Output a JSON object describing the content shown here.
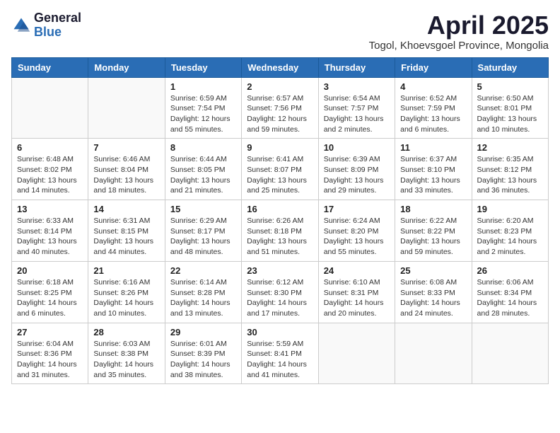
{
  "header": {
    "logo_general": "General",
    "logo_blue": "Blue",
    "month_title": "April 2025",
    "location": "Togol, Khoevsgoel Province, Mongolia"
  },
  "weekdays": [
    "Sunday",
    "Monday",
    "Tuesday",
    "Wednesday",
    "Thursday",
    "Friday",
    "Saturday"
  ],
  "weeks": [
    [
      {
        "day": "",
        "empty": true
      },
      {
        "day": "",
        "empty": true
      },
      {
        "day": "1",
        "line1": "Sunrise: 6:59 AM",
        "line2": "Sunset: 7:54 PM",
        "line3": "Daylight: 12 hours",
        "line4": "and 55 minutes."
      },
      {
        "day": "2",
        "line1": "Sunrise: 6:57 AM",
        "line2": "Sunset: 7:56 PM",
        "line3": "Daylight: 12 hours",
        "line4": "and 59 minutes."
      },
      {
        "day": "3",
        "line1": "Sunrise: 6:54 AM",
        "line2": "Sunset: 7:57 PM",
        "line3": "Daylight: 13 hours",
        "line4": "and 2 minutes."
      },
      {
        "day": "4",
        "line1": "Sunrise: 6:52 AM",
        "line2": "Sunset: 7:59 PM",
        "line3": "Daylight: 13 hours",
        "line4": "and 6 minutes."
      },
      {
        "day": "5",
        "line1": "Sunrise: 6:50 AM",
        "line2": "Sunset: 8:01 PM",
        "line3": "Daylight: 13 hours",
        "line4": "and 10 minutes."
      }
    ],
    [
      {
        "day": "6",
        "line1": "Sunrise: 6:48 AM",
        "line2": "Sunset: 8:02 PM",
        "line3": "Daylight: 13 hours",
        "line4": "and 14 minutes."
      },
      {
        "day": "7",
        "line1": "Sunrise: 6:46 AM",
        "line2": "Sunset: 8:04 PM",
        "line3": "Daylight: 13 hours",
        "line4": "and 18 minutes."
      },
      {
        "day": "8",
        "line1": "Sunrise: 6:44 AM",
        "line2": "Sunset: 8:05 PM",
        "line3": "Daylight: 13 hours",
        "line4": "and 21 minutes."
      },
      {
        "day": "9",
        "line1": "Sunrise: 6:41 AM",
        "line2": "Sunset: 8:07 PM",
        "line3": "Daylight: 13 hours",
        "line4": "and 25 minutes."
      },
      {
        "day": "10",
        "line1": "Sunrise: 6:39 AM",
        "line2": "Sunset: 8:09 PM",
        "line3": "Daylight: 13 hours",
        "line4": "and 29 minutes."
      },
      {
        "day": "11",
        "line1": "Sunrise: 6:37 AM",
        "line2": "Sunset: 8:10 PM",
        "line3": "Daylight: 13 hours",
        "line4": "and 33 minutes."
      },
      {
        "day": "12",
        "line1": "Sunrise: 6:35 AM",
        "line2": "Sunset: 8:12 PM",
        "line3": "Daylight: 13 hours",
        "line4": "and 36 minutes."
      }
    ],
    [
      {
        "day": "13",
        "line1": "Sunrise: 6:33 AM",
        "line2": "Sunset: 8:14 PM",
        "line3": "Daylight: 13 hours",
        "line4": "and 40 minutes."
      },
      {
        "day": "14",
        "line1": "Sunrise: 6:31 AM",
        "line2": "Sunset: 8:15 PM",
        "line3": "Daylight: 13 hours",
        "line4": "and 44 minutes."
      },
      {
        "day": "15",
        "line1": "Sunrise: 6:29 AM",
        "line2": "Sunset: 8:17 PM",
        "line3": "Daylight: 13 hours",
        "line4": "and 48 minutes."
      },
      {
        "day": "16",
        "line1": "Sunrise: 6:26 AM",
        "line2": "Sunset: 8:18 PM",
        "line3": "Daylight: 13 hours",
        "line4": "and 51 minutes."
      },
      {
        "day": "17",
        "line1": "Sunrise: 6:24 AM",
        "line2": "Sunset: 8:20 PM",
        "line3": "Daylight: 13 hours",
        "line4": "and 55 minutes."
      },
      {
        "day": "18",
        "line1": "Sunrise: 6:22 AM",
        "line2": "Sunset: 8:22 PM",
        "line3": "Daylight: 13 hours",
        "line4": "and 59 minutes."
      },
      {
        "day": "19",
        "line1": "Sunrise: 6:20 AM",
        "line2": "Sunset: 8:23 PM",
        "line3": "Daylight: 14 hours",
        "line4": "and 2 minutes."
      }
    ],
    [
      {
        "day": "20",
        "line1": "Sunrise: 6:18 AM",
        "line2": "Sunset: 8:25 PM",
        "line3": "Daylight: 14 hours",
        "line4": "and 6 minutes."
      },
      {
        "day": "21",
        "line1": "Sunrise: 6:16 AM",
        "line2": "Sunset: 8:26 PM",
        "line3": "Daylight: 14 hours",
        "line4": "and 10 minutes."
      },
      {
        "day": "22",
        "line1": "Sunrise: 6:14 AM",
        "line2": "Sunset: 8:28 PM",
        "line3": "Daylight: 14 hours",
        "line4": "and 13 minutes."
      },
      {
        "day": "23",
        "line1": "Sunrise: 6:12 AM",
        "line2": "Sunset: 8:30 PM",
        "line3": "Daylight: 14 hours",
        "line4": "and 17 minutes."
      },
      {
        "day": "24",
        "line1": "Sunrise: 6:10 AM",
        "line2": "Sunset: 8:31 PM",
        "line3": "Daylight: 14 hours",
        "line4": "and 20 minutes."
      },
      {
        "day": "25",
        "line1": "Sunrise: 6:08 AM",
        "line2": "Sunset: 8:33 PM",
        "line3": "Daylight: 14 hours",
        "line4": "and 24 minutes."
      },
      {
        "day": "26",
        "line1": "Sunrise: 6:06 AM",
        "line2": "Sunset: 8:34 PM",
        "line3": "Daylight: 14 hours",
        "line4": "and 28 minutes."
      }
    ],
    [
      {
        "day": "27",
        "line1": "Sunrise: 6:04 AM",
        "line2": "Sunset: 8:36 PM",
        "line3": "Daylight: 14 hours",
        "line4": "and 31 minutes."
      },
      {
        "day": "28",
        "line1": "Sunrise: 6:03 AM",
        "line2": "Sunset: 8:38 PM",
        "line3": "Daylight: 14 hours",
        "line4": "and 35 minutes."
      },
      {
        "day": "29",
        "line1": "Sunrise: 6:01 AM",
        "line2": "Sunset: 8:39 PM",
        "line3": "Daylight: 14 hours",
        "line4": "and 38 minutes."
      },
      {
        "day": "30",
        "line1": "Sunrise: 5:59 AM",
        "line2": "Sunset: 8:41 PM",
        "line3": "Daylight: 14 hours",
        "line4": "and 41 minutes."
      },
      {
        "day": "",
        "empty": true
      },
      {
        "day": "",
        "empty": true
      },
      {
        "day": "",
        "empty": true
      }
    ]
  ]
}
